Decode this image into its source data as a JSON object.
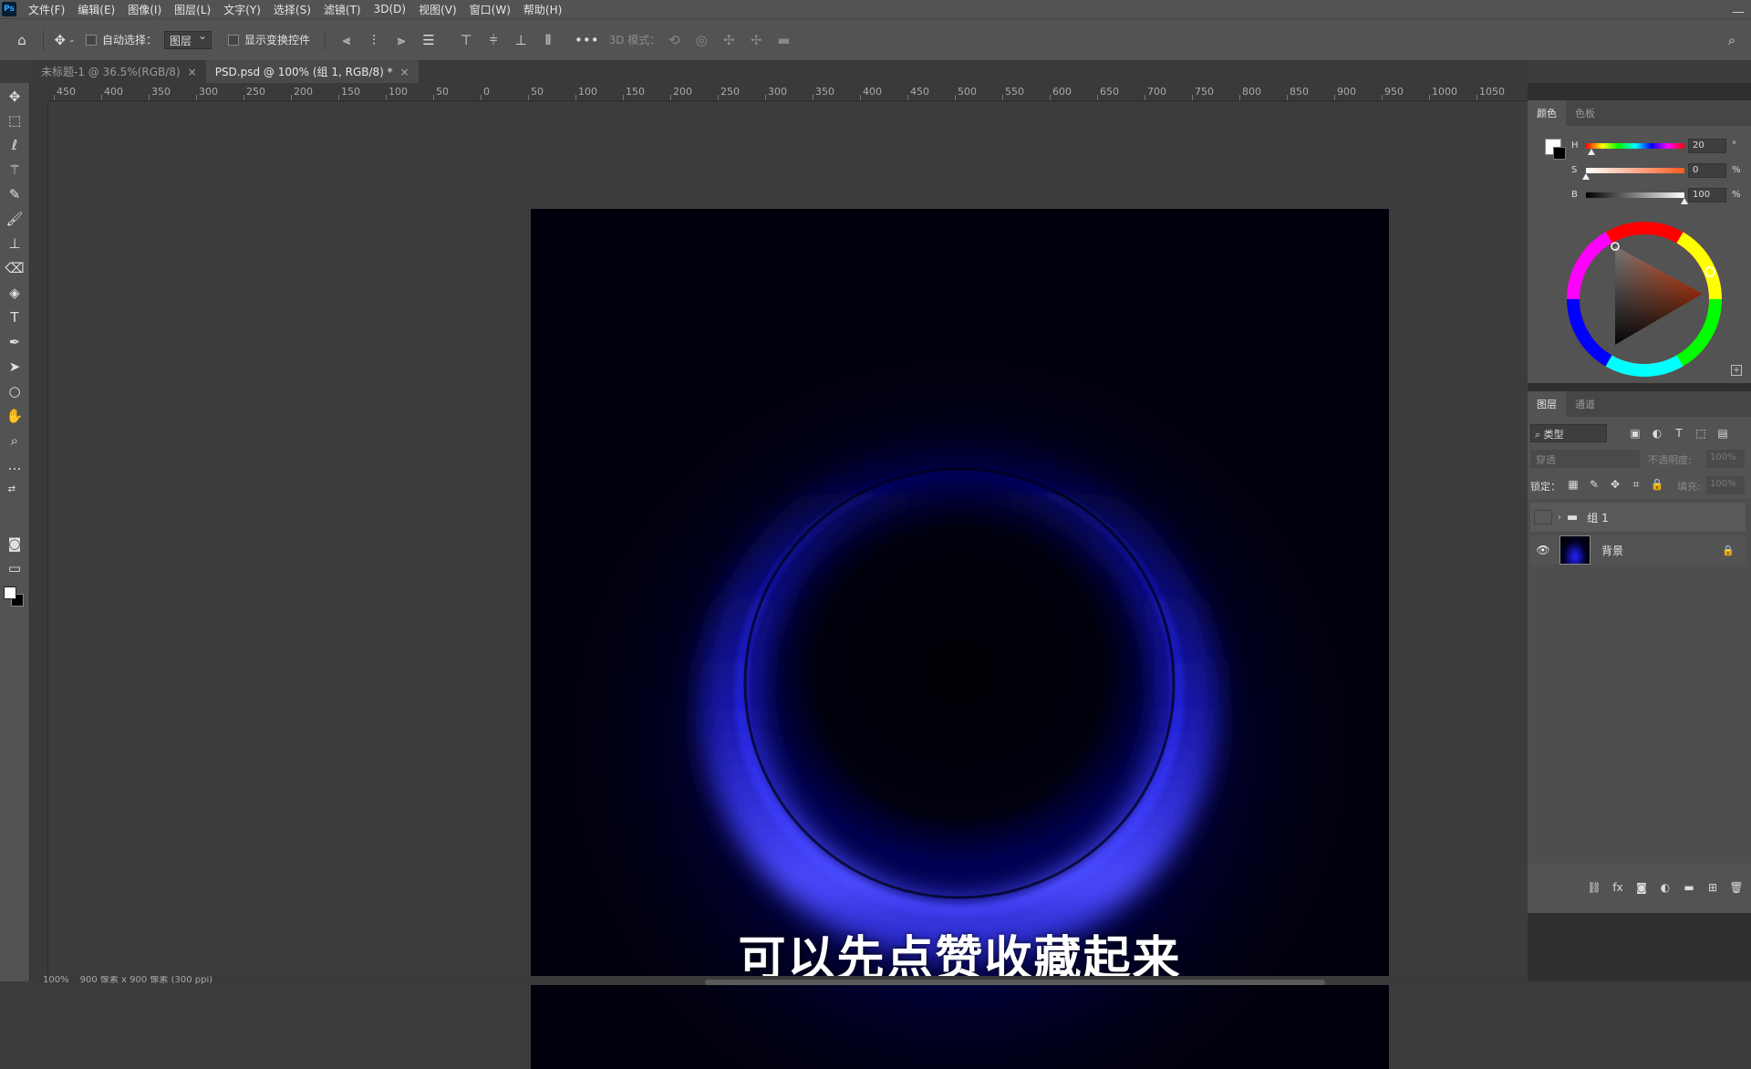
{
  "menubar": {
    "logo": "Ps",
    "items": [
      "文件(F)",
      "编辑(E)",
      "图像(I)",
      "图层(L)",
      "文字(Y)",
      "选择(S)",
      "滤镜(T)",
      "3D(D)",
      "视图(V)",
      "窗口(W)",
      "帮助(H)"
    ]
  },
  "options": {
    "auto_select_label": "自动选择：",
    "auto_select_value": "图层",
    "show_transform_label": "显示变换控件",
    "mode_3d_label": "3D 模式："
  },
  "tabs": [
    {
      "label": "未标题-1 @ 36.5%(RGB/8)",
      "close": "×"
    },
    {
      "label": "PSD.psd @ 100% (组 1, RGB/8) *",
      "close": "×"
    }
  ],
  "ruler": {
    "h_labels": [
      "450",
      "400",
      "350",
      "300",
      "250",
      "200",
      "150",
      "100",
      "50",
      "0",
      "50",
      "100",
      "150",
      "200",
      "250",
      "300",
      "350",
      "400",
      "450",
      "500",
      "550",
      "600",
      "650",
      "700",
      "750",
      "800",
      "850",
      "900",
      "950",
      "1000",
      "1050"
    ]
  },
  "canvas": {
    "subtitle": "可以先点赞收藏起来",
    "background_color": "#00000c",
    "glow_color": "#1a1aff"
  },
  "status": {
    "zoom": "100%",
    "doc_info": "900 像素 x 900 像素 (300 ppi)"
  },
  "color_panel": {
    "tabs": [
      "颜色",
      "色板"
    ],
    "h_label": "H",
    "h_value": "20",
    "h_unit": "°",
    "h_level": 0.06,
    "s_label": "S",
    "s_value": "0",
    "s_unit": "%",
    "s_level": 0.0,
    "b_label": "B",
    "b_value": "100",
    "b_unit": "%",
    "b_level": 1.0
  },
  "layers_panel": {
    "tabs": [
      "图层",
      "通道"
    ],
    "filter_label": "类型",
    "blend_mode": "穿透",
    "opacity_label": "不透明度:",
    "opacity_value": "100%",
    "lock_label": "锁定：",
    "fill_label": "填充:",
    "fill_value": "100%",
    "layers": [
      {
        "name": "组 1",
        "type": "group",
        "visible": false
      },
      {
        "name": "背景",
        "type": "background",
        "visible": true,
        "locked": true
      }
    ]
  }
}
